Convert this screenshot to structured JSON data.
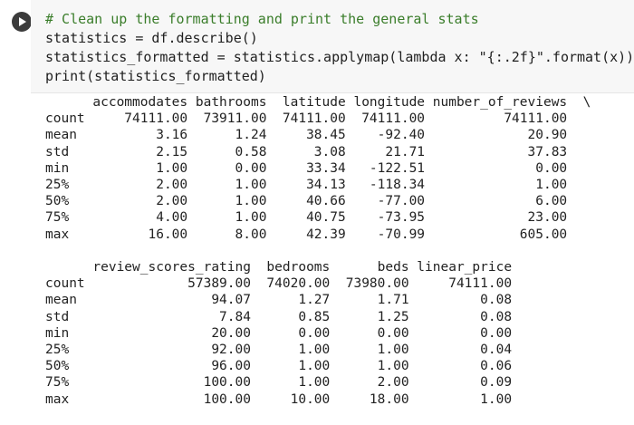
{
  "code_lines": [
    "# Clean up the formatting and print the general stats",
    "statistics = df.describe()",
    "statistics_formatted = statistics.applymap(lambda x: \"{:.2f}\".format(x))",
    "print(statistics_formatted)"
  ],
  "output_text": "      accommodates bathrooms  latitude longitude number_of_reviews  \\\ncount     74111.00  73911.00  74111.00  74111.00          74111.00   \nmean          3.16      1.24     38.45    -92.40             20.90   \nstd           2.15      0.58      3.08     21.71             37.83   \nmin           1.00      0.00     33.34   -122.51              0.00   \n25%           2.00      1.00     34.13   -118.34              1.00   \n50%           2.00      1.00     40.66    -77.00              6.00   \n75%           4.00      1.00     40.75    -73.95             23.00   \nmax          16.00      8.00     42.39    -70.99            605.00   \n\n      review_scores_rating  bedrooms      beds linear_price  \ncount             57389.00  74020.00  73980.00     74111.00  \nmean                 94.07      1.27      1.71         0.08  \nstd                   7.84      0.85      1.25         0.08  \nmin                  20.00      0.00      0.00         0.00  \n25%                  92.00      1.00      1.00         0.04  \n50%                  96.00      1.00      1.00         0.06  \n75%                 100.00      1.00      2.00         0.09  \nmax                 100.00     10.00     18.00         1.00  ",
  "icons": {
    "run": "play-circle-icon"
  },
  "colors": {
    "comment": "#3a7d2a",
    "string": "#b5442c",
    "code_bg": "#f7f7f7"
  }
}
